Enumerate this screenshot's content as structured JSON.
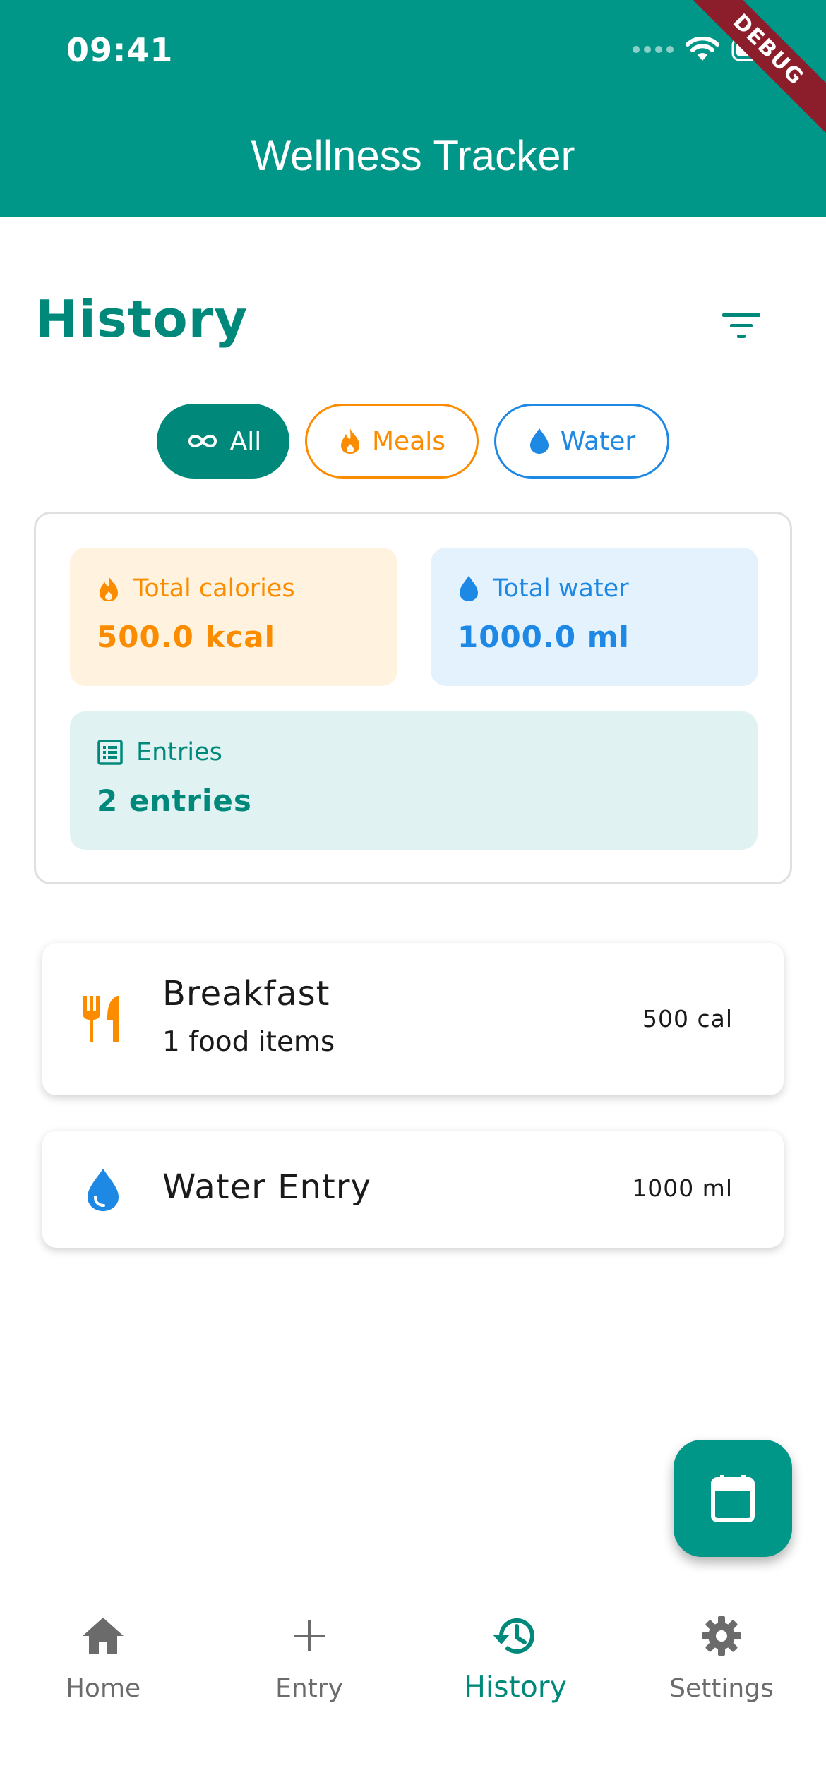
{
  "status_bar": {
    "time": "09:41"
  },
  "app_bar": {
    "title": "Wellness Tracker",
    "debug_label": "DEBUG"
  },
  "header": {
    "title": "History"
  },
  "filters": [
    {
      "label": "All",
      "icon": "infinity-icon",
      "selected": true
    },
    {
      "label": "Meals",
      "icon": "flame-icon",
      "selected": false
    },
    {
      "label": "Water",
      "icon": "water-drop-icon",
      "selected": false
    }
  ],
  "summary": {
    "calories": {
      "label": "Total calories",
      "value": "500.0 kcal"
    },
    "water": {
      "label": "Total water",
      "value": "1000.0 ml"
    },
    "entries": {
      "label": "Entries",
      "value": "2 entries"
    }
  },
  "entries": [
    {
      "title": "Breakfast",
      "subtitle": "1 food items",
      "value": "500 cal",
      "icon": "restaurant-icon"
    },
    {
      "title": "Water Entry",
      "value": "1000 ml",
      "icon": "water-drop-icon"
    }
  ],
  "fab": {
    "icon": "calendar-icon"
  },
  "bottom_nav": [
    {
      "label": "Home",
      "icon": "home-icon"
    },
    {
      "label": "Entry",
      "icon": "plus-icon"
    },
    {
      "label": "History",
      "icon": "history-icon",
      "active": true
    },
    {
      "label": "Settings",
      "icon": "gear-icon"
    }
  ],
  "colors": {
    "primary": "#009688",
    "meals": "#fb8c00",
    "water": "#1e88e5",
    "inactive_nav": "#6b6b6b"
  }
}
